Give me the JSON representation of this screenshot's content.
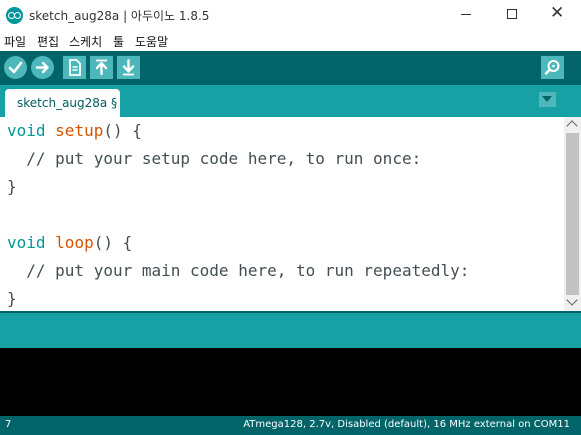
{
  "window": {
    "title": "sketch_aug28a | 아두이노 1.8.5",
    "minimize_glyph": "",
    "close_glyph": "✕"
  },
  "menu": [
    "파일",
    "편집",
    "스케치",
    "툴",
    "도움말"
  ],
  "toolbar": {
    "buttons": [
      {
        "name": "verify-button",
        "icon": "check-icon"
      },
      {
        "name": "upload-button",
        "icon": "arrow-right-icon"
      },
      {
        "name": "new-button",
        "icon": "document-icon"
      },
      {
        "name": "open-button",
        "icon": "arrow-up-icon"
      },
      {
        "name": "save-button",
        "icon": "arrow-down-icon"
      }
    ],
    "serial_monitor_icon": "magnifier-icon"
  },
  "tabs": [
    {
      "label": "sketch_aug28a §",
      "active": true
    }
  ],
  "editor": {
    "line1": {
      "kw": "void",
      "fn": "setup",
      "rest": "() {"
    },
    "line2": {
      "comment": "  // put your setup code here, to run once:"
    },
    "line3": {
      "text": "}"
    },
    "line5": {
      "kw": "void",
      "fn": "loop",
      "rest": "() {"
    },
    "line6": {
      "comment": "  // put your main code here, to run repeatedly:"
    },
    "line7": {
      "text": "}"
    }
  },
  "status": {
    "line_number": "7",
    "board": "ATmega128, 2.7v, Disabled (default), 16 MHz external on COM11"
  },
  "colors": {
    "toolbar": "#006468",
    "tabbar": "#17a1a5",
    "button": "#4db7bb",
    "keyword": "#00979c",
    "function": "#d35400"
  }
}
